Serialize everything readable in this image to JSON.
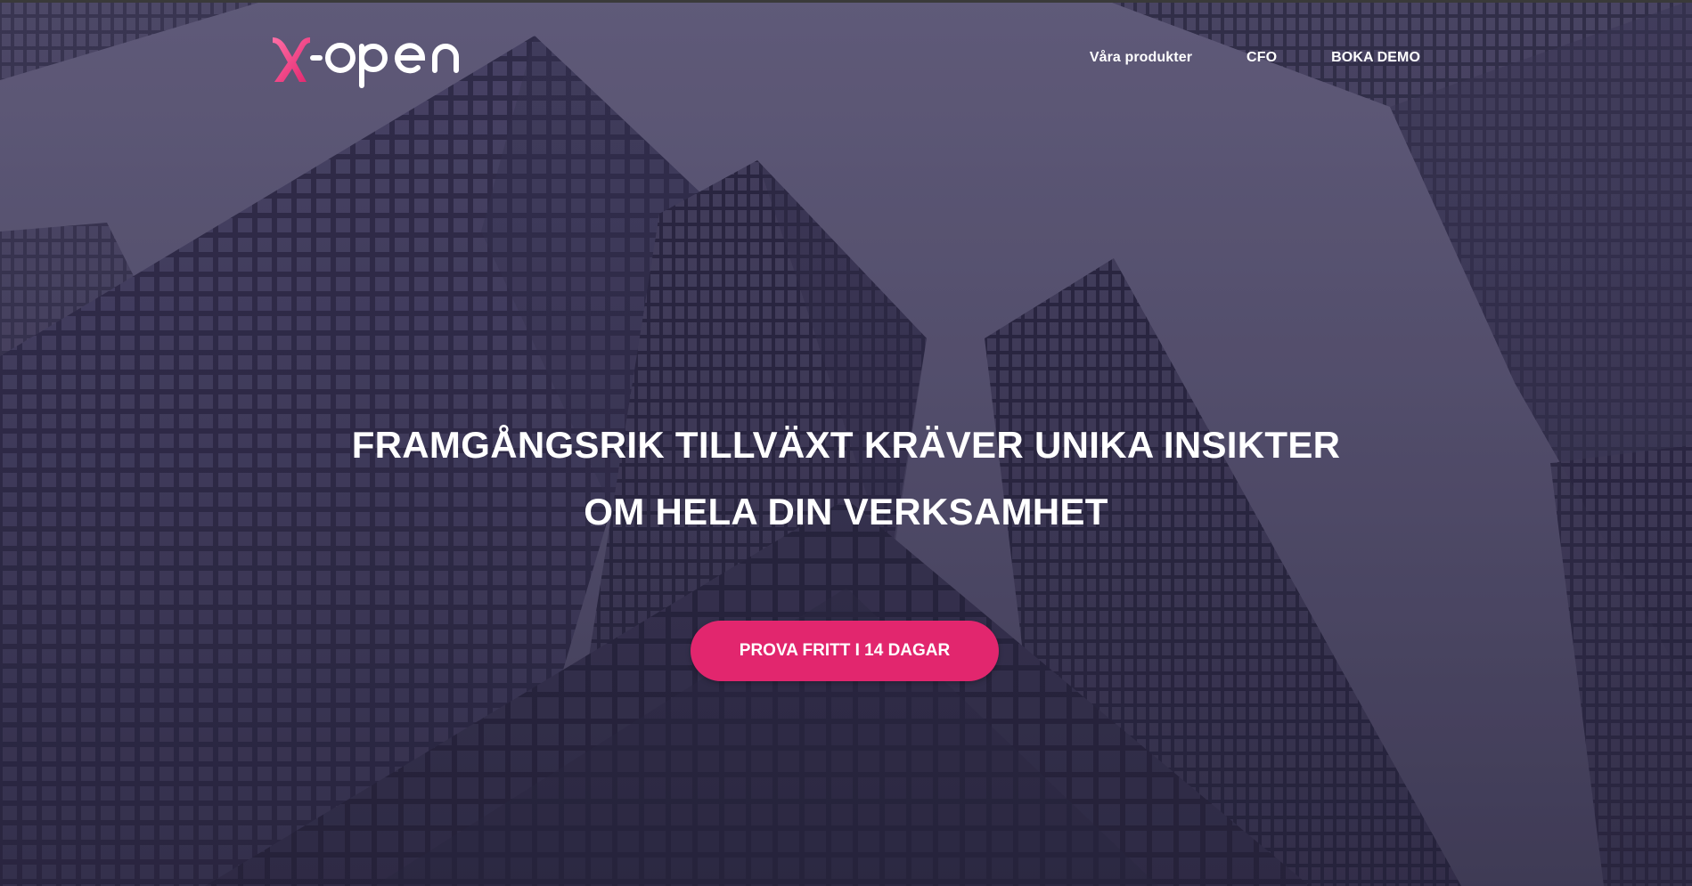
{
  "brand": {
    "logo_text_x": "x",
    "logo_text_rest": "-open",
    "accent_color": "#e2266e"
  },
  "nav": {
    "items": [
      {
        "label": "Våra produkter"
      },
      {
        "label": "CFO"
      },
      {
        "label": "BOKA DEMO"
      }
    ]
  },
  "hero": {
    "headline_line1": "FRAMGÅNGSRIK TILLVÄXT KRÄVER UNIKA INSIKTER",
    "headline_line2": "OM HELA DIN VERKSAMHET",
    "cta_label": "PROVA FRITT I 14 DAGAR",
    "background_image": "skyscrapers-looking-up"
  }
}
